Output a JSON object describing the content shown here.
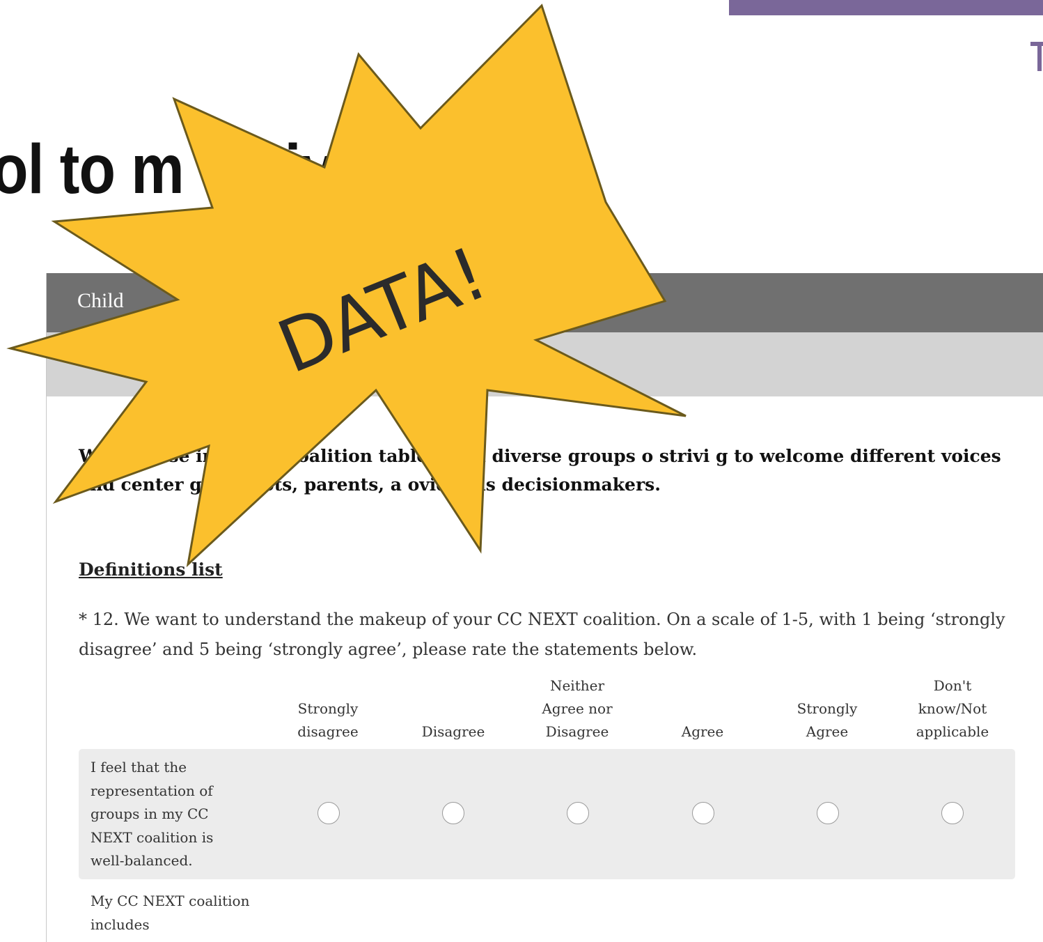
{
  "slide": {
    "title": "ol to m              ective Power"
  },
  "survey": {
    "header_title": "Child",
    "intro": "W                   es are se   ing their coalition tables with diverse groups o                strivi  g to welcome different voices and center grassroots, parents, a       ovider  as decisionmakers.",
    "definitions_link": "Definitions list",
    "question": "* 12. We want to understand the makeup of your CC NEXT coalition. On a scale of 1-5, with 1 being ‘strongly disagree’ and 5 being ‘strongly agree’, please rate the statements below.",
    "columns": [
      "Strongly disagree",
      "Disagree",
      "Neither Agree nor Disagree",
      "Agree",
      "Strongly Agree",
      "Don't know/Not applicable"
    ],
    "rows": [
      {
        "label": "I feel that the representation of groups in my CC NEXT coalition is well-balanced."
      },
      {
        "label": "My CC NEXT coalition includes"
      }
    ]
  },
  "burst": {
    "text": "DATA!",
    "fill": "#fbc02d",
    "stroke": "#6b5a1c"
  }
}
